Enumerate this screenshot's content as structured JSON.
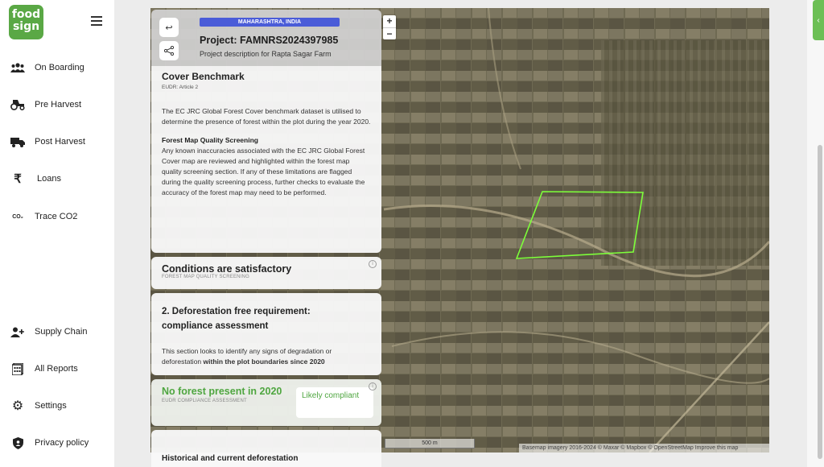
{
  "brand": {
    "logo_line1": "food",
    "logo_line2": "sign"
  },
  "sidebar": {
    "items": [
      {
        "label": "On Boarding",
        "icon": "users-icon"
      },
      {
        "label": "Pre Harvest",
        "icon": "tractor-icon"
      },
      {
        "label": "Post Harvest",
        "icon": "truck-icon"
      },
      {
        "label": "Loans",
        "icon": "rupee-icon"
      },
      {
        "label": "Trace CO2",
        "icon": "co2-icon"
      },
      {
        "label": "Supply Chain",
        "icon": "user-plus-icon"
      },
      {
        "label": "All Reports",
        "icon": "reports-icon"
      },
      {
        "label": "Settings",
        "icon": "gear-icon"
      },
      {
        "label": "Privacy policy",
        "icon": "shield-icon"
      }
    ]
  },
  "project": {
    "region": "MAHARASHTRA, INDIA",
    "title": "Project: FAMNRS2024397985",
    "description": "Project description for Rapta Sagar Farm"
  },
  "cover_benchmark": {
    "title": "Cover Benchmark",
    "subtitle": "EUDR: Article 2",
    "paragraph": "The EC JRC Global Forest Cover benchmark dataset is utilised to determine the presence of forest within the plot during the year 2020.",
    "screening_title": "Forest Map Quality Screening",
    "screening_text": "Any known inaccuracies associated with the EC JRC Global Forest Cover map are reviewed and highlighted within the forest map quality screening section. If any of these limitations are flagged during the quality screening process, further checks to evaluate the accuracy of the forest map may need to be performed."
  },
  "conditions": {
    "title": "Conditions are satisfactory",
    "subtitle": "FOREST MAP QUALITY SCREENING",
    "info": "i"
  },
  "deforestation": {
    "title": "2. Deforestation free requirement: compliance assessment",
    "text_plain": "This section looks to identify any signs of degradation or deforestation ",
    "text_bold": "within the plot boundaries since 2020"
  },
  "forest_status": {
    "title": "No forest present in 2020",
    "subtitle": "EUDR COMPLIANCE ASSESSMENT",
    "verdict": "Likely compliant",
    "info": "i",
    "accent_color": "#4fa640"
  },
  "history": {
    "title": "Historical and current deforestation"
  },
  "map": {
    "zoom_in": "+",
    "zoom_out": "−",
    "scale_label": "500 m",
    "attribution": "Basemap imagery 2016-2024  © Maxar  © Mapbox  © OpenStreetMap  Improve this map",
    "polygon_color": "#7dff3a"
  }
}
